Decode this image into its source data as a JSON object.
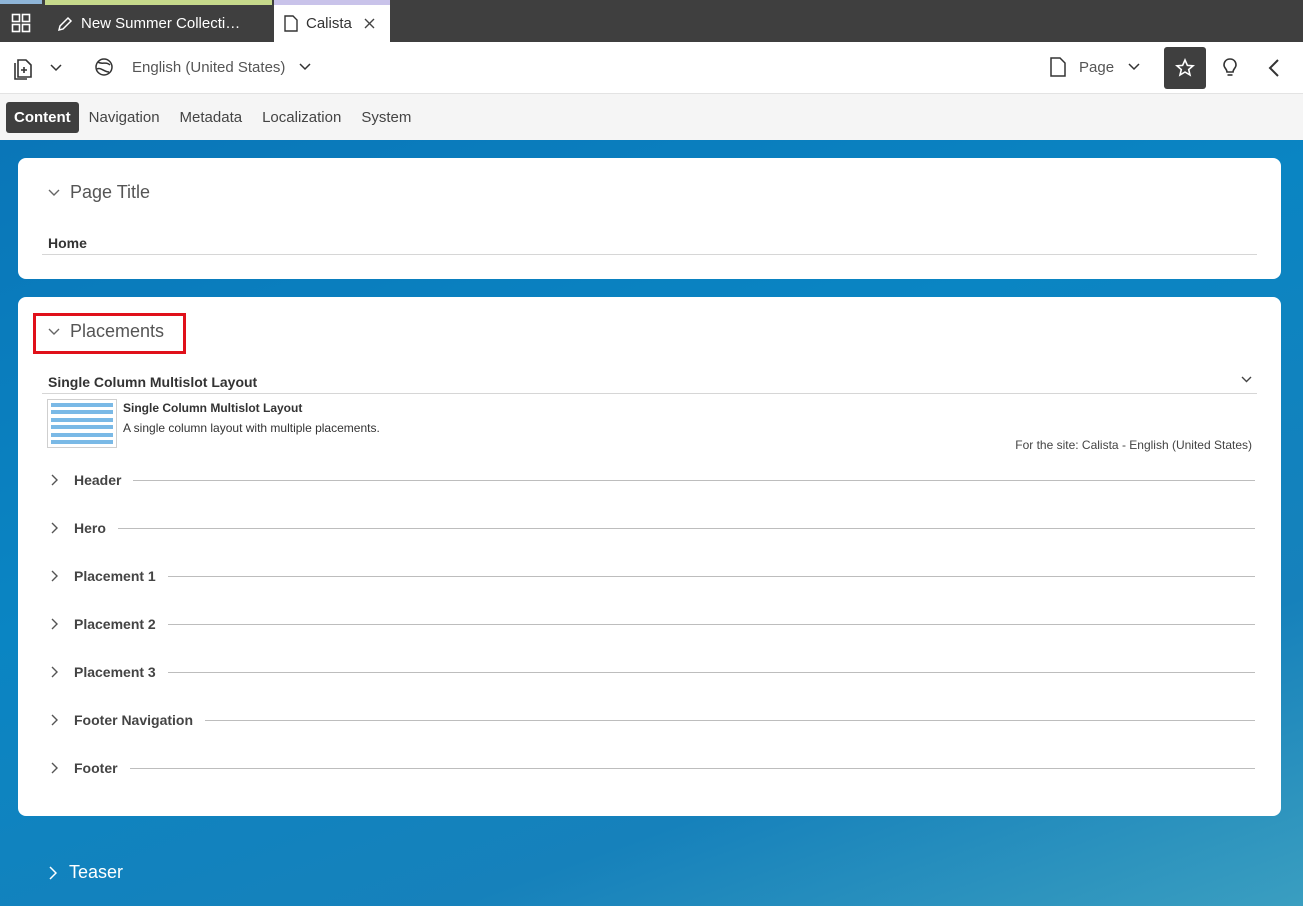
{
  "tabs": {
    "doc1_title": "New Summer Collecti…",
    "doc2_title": "Calista"
  },
  "toolbar": {
    "language": "English (United States)",
    "doc_type": "Page"
  },
  "subtabs": [
    "Content",
    "Navigation",
    "Metadata",
    "Localization",
    "System"
  ],
  "page_title_section": {
    "heading": "Page Title",
    "value": "Home"
  },
  "placements_section": {
    "heading": "Placements",
    "layout_select": "Single Column Multislot Layout",
    "layout_name": "Single Column Multislot Layout",
    "layout_desc": "A single column layout with multiple placements.",
    "site_note": "For the site: Calista - English (United States)",
    "rows": [
      "Header",
      "Hero",
      "Placement 1",
      "Placement 2",
      "Placement 3",
      "Footer Navigation",
      "Footer"
    ]
  },
  "teaser": {
    "heading": "Teaser"
  },
  "colors": {
    "highlight": "#e0101a",
    "dark": "#3f3f3f",
    "background_blue": "#0a80c0"
  }
}
